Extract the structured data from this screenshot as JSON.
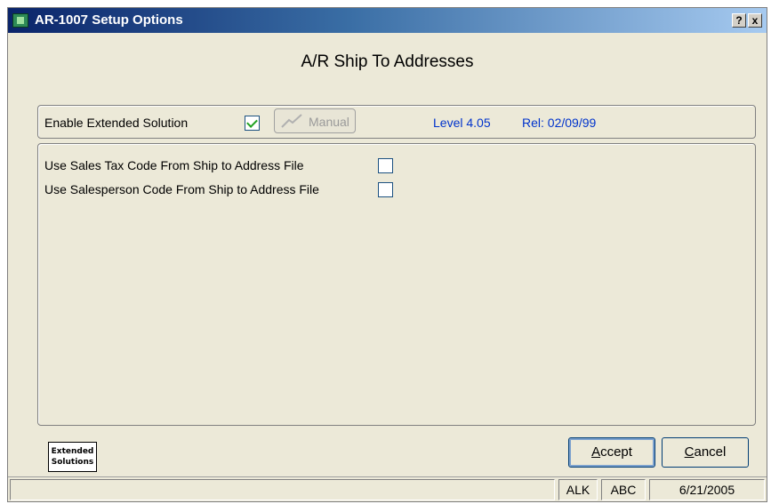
{
  "window": {
    "title": "AR-1007 Setup Options",
    "help_label": "?",
    "close_label": "x"
  },
  "heading": "A/R Ship To Addresses",
  "extended": {
    "enable_label": "Enable Extended Solution",
    "enable_checked": true,
    "manual_label": "Manual",
    "level_text": "Level 4.05",
    "rel_text": "Rel: 02/09/99"
  },
  "options": [
    {
      "label": "Use Sales Tax Code From Ship to Address File",
      "checked": false
    },
    {
      "label": "Use Salesperson Code From Ship to Address File",
      "checked": false
    }
  ],
  "logo": {
    "line1": "Extended",
    "line2": "Solutions"
  },
  "buttons": {
    "accept_first": "A",
    "accept_rest": "ccept",
    "cancel_first": "C",
    "cancel_rest": "ancel"
  },
  "statusbar": {
    "user": "ALK",
    "company": "ABC",
    "date": "6/21/2005"
  },
  "colors": {
    "accent_blue": "#0033cc",
    "titlebar_start": "#0a246a",
    "check_green": "#21a121"
  }
}
